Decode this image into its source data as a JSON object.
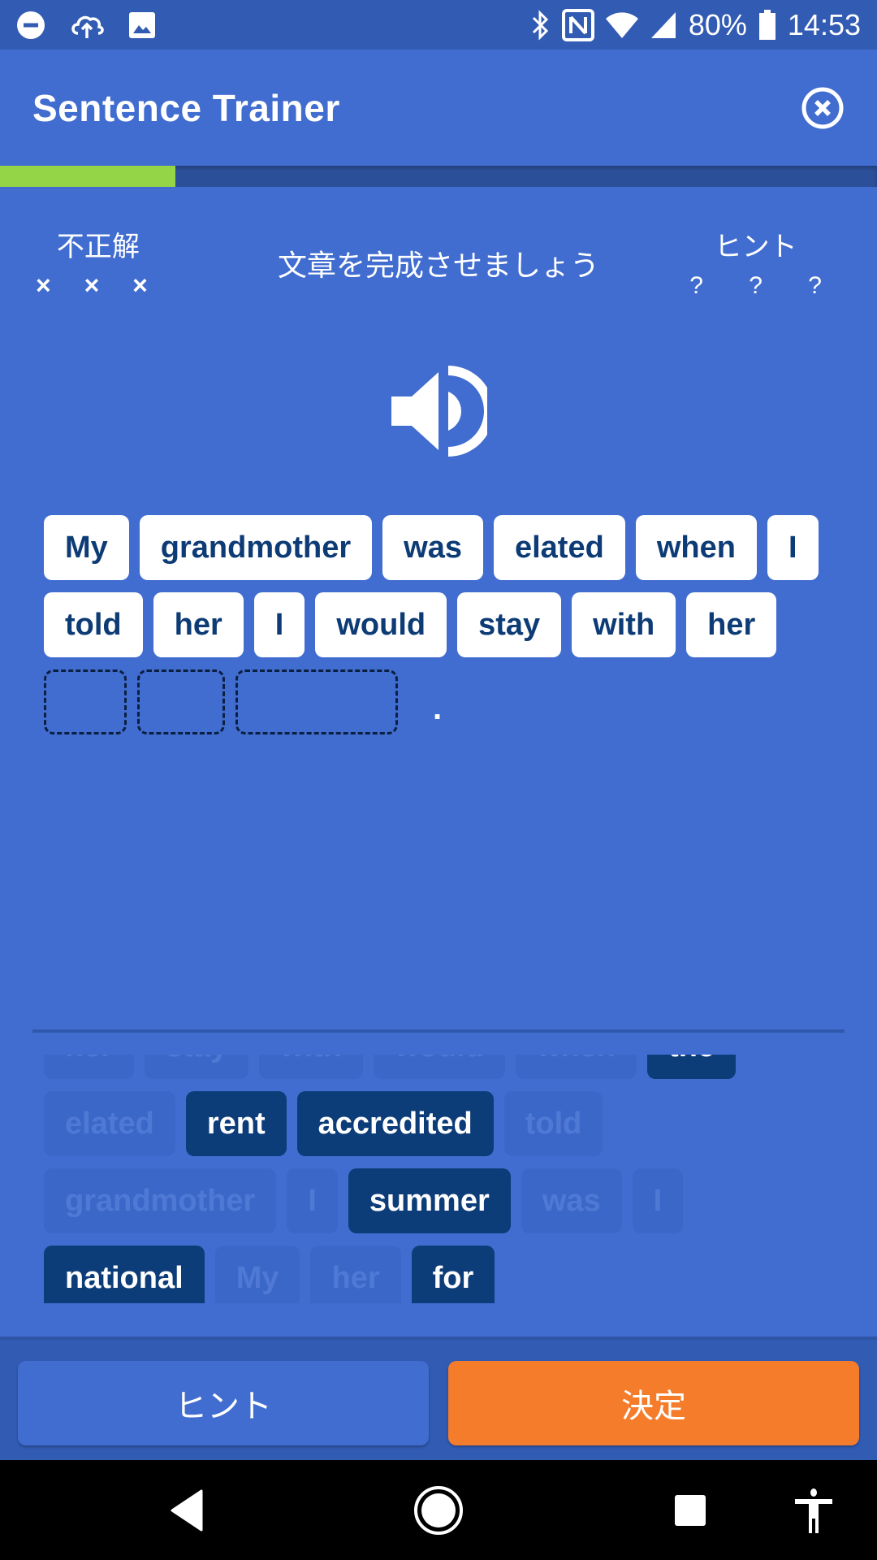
{
  "status_bar": {
    "left_icons": [
      "do-not-disturb-icon",
      "cloud-upload-icon",
      "image-icon"
    ],
    "right_icons": [
      "bluetooth-icon",
      "nfc-icon",
      "wifi-icon",
      "signal-icon",
      "battery-icon"
    ],
    "battery": "80%",
    "time": "14:53"
  },
  "app_bar": {
    "title": "Sentence Trainer",
    "close_icon": "close-circle-icon"
  },
  "progress": {
    "fraction": 0.2,
    "fill_color": "#94d447"
  },
  "info": {
    "wrong_label": "不正解",
    "wrong_marks": "× × ×",
    "instruction": "文章を完成させましょう",
    "hint_label": "ヒント",
    "hint_marks": "? ? ?"
  },
  "speaker_icon": "speaker-icon",
  "sentence": {
    "rows": [
      [
        "My",
        "grandmother",
        "was",
        "elated",
        "when",
        "I"
      ],
      [
        "told",
        "her",
        "I",
        "would",
        "stay",
        "with",
        "her"
      ]
    ],
    "empty_slots": 3,
    "period": "."
  },
  "word_bank": {
    "rows": [
      [
        {
          "word": "her",
          "used": true
        },
        {
          "word": "stay",
          "used": true
        },
        {
          "word": "with",
          "used": true
        },
        {
          "word": "would",
          "used": true
        },
        {
          "word": "when",
          "used": true
        },
        {
          "word": "the",
          "used": false
        }
      ],
      [
        {
          "word": "elated",
          "used": true
        },
        {
          "word": "rent",
          "used": false
        },
        {
          "word": "accredited",
          "used": false
        },
        {
          "word": "told",
          "used": true
        }
      ],
      [
        {
          "word": "grandmother",
          "used": true
        },
        {
          "word": "I",
          "used": true
        },
        {
          "word": "summer",
          "used": false
        },
        {
          "word": "was",
          "used": true
        },
        {
          "word": "I",
          "used": true
        }
      ],
      [
        {
          "word": "national",
          "used": false
        },
        {
          "word": "My",
          "used": true
        },
        {
          "word": "her",
          "used": true
        },
        {
          "word": "for",
          "used": false
        }
      ]
    ]
  },
  "buttons": {
    "hint": "ヒント",
    "submit": "決定",
    "submit_color": "#f47c2b"
  },
  "nav_bar": {
    "icons": [
      "back-icon",
      "home-icon",
      "recents-icon",
      "accessibility-icon"
    ]
  }
}
